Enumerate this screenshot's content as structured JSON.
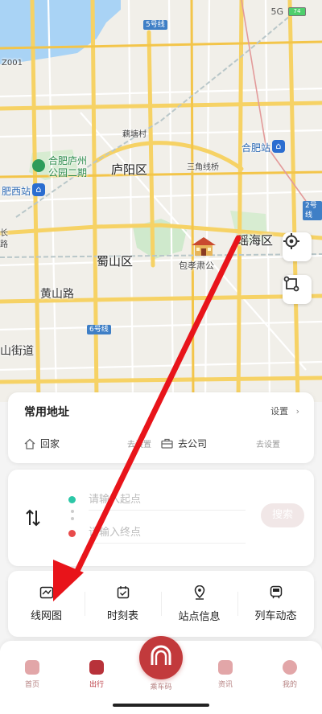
{
  "status_bar": {
    "signal": "5G",
    "battery": "74"
  },
  "map": {
    "labels": {
      "hefei_station": "合肥站",
      "yaohai": "瑶海区",
      "luyang": "庐阳区",
      "shushan": "蜀山区",
      "huangshan_rd": "黄山路",
      "outou": "藕塘村",
      "sanjiao": "三角线桥",
      "park": "合肥庐州\n公园二期",
      "west_station": "肥西站",
      "baogong": "包孝肃公",
      "chang": "长\n路",
      "street": "山街道",
      "code": "Z001"
    },
    "road_badges": {
      "line5": "5号线",
      "line2": "2号线",
      "line6": "6号线"
    },
    "buttons": {
      "locate_icon": "crosshair-icon",
      "route_icon": "route-icon"
    }
  },
  "address_card": {
    "title": "常用地址",
    "settings_label": "设置",
    "home_label": "回家",
    "home_set": "去设置",
    "work_label": "去公司",
    "work_set": "去设置"
  },
  "route_card": {
    "start_placeholder": "请输入起点",
    "end_placeholder": "请输入终点",
    "search_label": "搜索"
  },
  "tools": [
    {
      "label": "线网图",
      "icon": "line-map-icon"
    },
    {
      "label": "时刻表",
      "icon": "calendar-icon"
    },
    {
      "label": "站点信息",
      "icon": "location-pin-icon"
    },
    {
      "label": "列车动态",
      "icon": "train-icon"
    }
  ],
  "bottom_nav": {
    "home": "首页",
    "travel": "出行",
    "ride_code": "乘车码",
    "news": "资讯",
    "mine": "我的"
  },
  "colors": {
    "accent": "#b8323a",
    "arrow": "#e8141a",
    "route_start": "#2cc7a7",
    "route_end": "#e84b4b"
  }
}
